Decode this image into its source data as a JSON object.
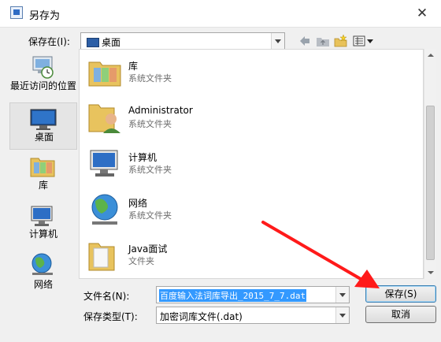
{
  "window": {
    "title": "另存为",
    "close_glyph": "✕"
  },
  "save_in": {
    "label": "保存在(I):",
    "value": "桌面"
  },
  "places": [
    {
      "label": "最近访问的位置"
    },
    {
      "label": "桌面"
    },
    {
      "label": "库"
    },
    {
      "label": "计算机"
    },
    {
      "label": "网络"
    }
  ],
  "files": [
    {
      "name": "库",
      "type": "系统文件夹",
      "icon": "library-folder-icon"
    },
    {
      "name": "Administrator",
      "type": "系统文件夹",
      "icon": "user-folder-icon"
    },
    {
      "name": "计算机",
      "type": "系统文件夹",
      "icon": "computer-icon"
    },
    {
      "name": "网络",
      "type": "系统文件夹",
      "icon": "network-globe-icon"
    },
    {
      "name": "Java面试",
      "type": "文件夹",
      "icon": "folder-icon"
    }
  ],
  "filename": {
    "label": "文件名(N):",
    "value": "百度输入法词库导出_2015_7_7.dat"
  },
  "filetype": {
    "label": "保存类型(T):",
    "value": "加密词库文件(.dat)"
  },
  "buttons": {
    "save": "保存(S)",
    "cancel": "取消"
  },
  "colors": {
    "accent": "#3399ff",
    "annotation_arrow": "#ff1a1a"
  }
}
